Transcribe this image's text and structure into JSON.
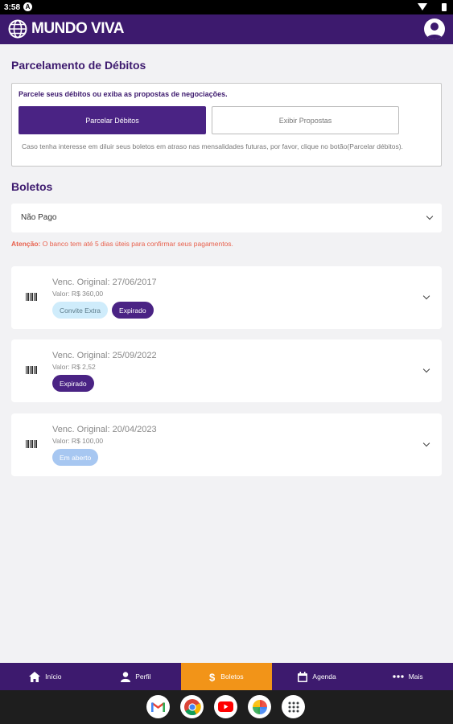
{
  "status_bar": {
    "time": "3:58",
    "notification_icon": "A"
  },
  "app_bar": {
    "brand": "MUNDO VIVA",
    "logo_icon": "globe-icon",
    "profile_icon": "user-avatar-icon"
  },
  "parcelamento": {
    "title": "Parcelamento de Débitos",
    "description": "Parcele seus débitos ou exiba as propostas de negociações.",
    "primary_button": "Parcelar Débitos",
    "secondary_button": "Exibir Propostas",
    "hint": "Caso tenha interesse em diluir seus boletos em atraso nas mensalidades futuras, por favor, clique no botão(Parcelar débitos)."
  },
  "boletos": {
    "title": "Boletos",
    "filter_value": "Não Pago",
    "notice_label": "Atenção:",
    "notice_text": " O banco tem até 5 dias úteis para confirmar seus pagamentos.",
    "items": [
      {
        "date": "Venc. Original: 27/06/2017",
        "value": "Valor: R$ 360,00",
        "tags": [
          "Convite Extra",
          "Expirado"
        ]
      },
      {
        "date": "Venc. Original: 25/09/2022",
        "value": "Valor: R$ 2,52",
        "tags": [
          "Expirado"
        ]
      },
      {
        "date": "Venc. Original: 20/04/2023",
        "value": "Valor: R$ 100,00",
        "tags": [
          "Em aberto"
        ]
      }
    ]
  },
  "bottom_nav": [
    {
      "label": "Início",
      "icon": "home-icon"
    },
    {
      "label": "Perfil",
      "icon": "person-icon"
    },
    {
      "label": "Boletos",
      "icon": "dollar-icon",
      "active": true
    },
    {
      "label": "Agenda",
      "icon": "calendar-icon"
    },
    {
      "label": "Mais",
      "icon": "more-dots-icon"
    }
  ],
  "dock_apps": [
    "gmail-icon",
    "chrome-icon",
    "youtube-icon",
    "photos-icon",
    "app-drawer-icon"
  ],
  "colors": {
    "primary": "#3d1a6e",
    "button": "#4a2384",
    "active_nav": "#f29418",
    "notice": "#e8604c",
    "open_tag": "#a7c7f1"
  }
}
